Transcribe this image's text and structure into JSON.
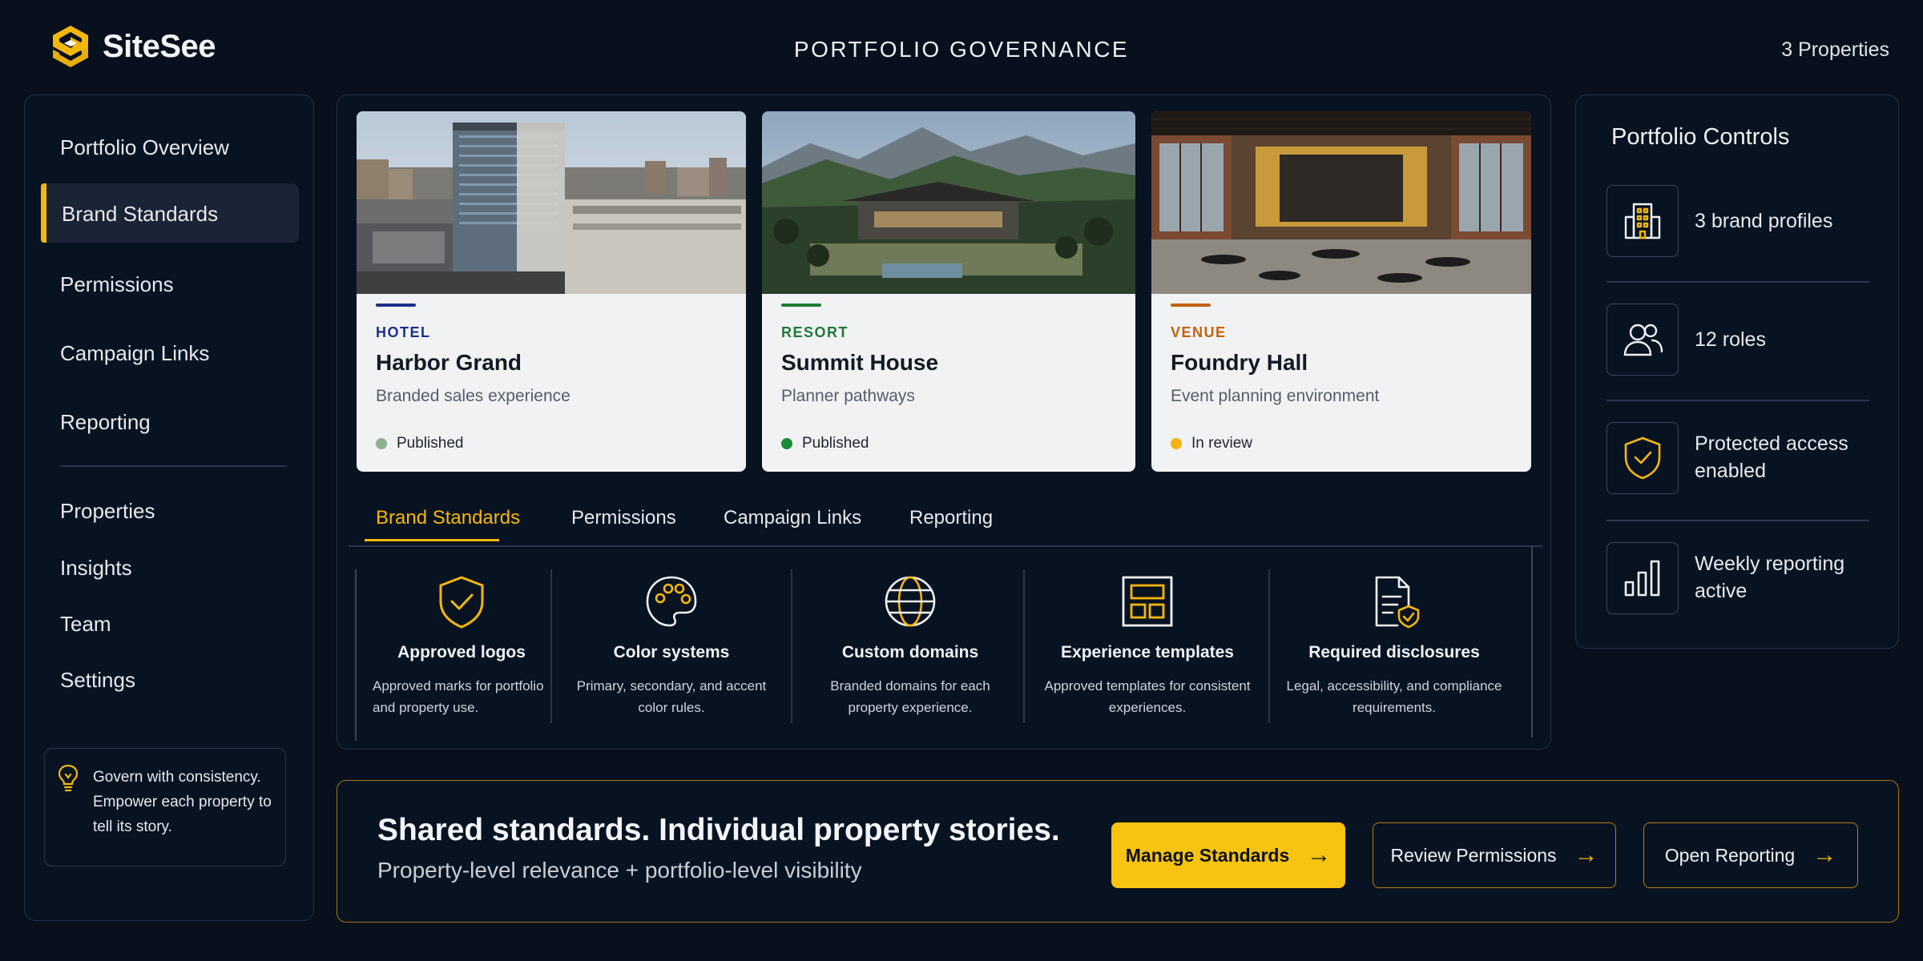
{
  "header": {
    "app_name": "SiteSee",
    "title": "PORTFOLIO GOVERNANCE",
    "property_count": "3 Properties"
  },
  "sidebar": {
    "items": [
      {
        "label": "Portfolio Overview"
      },
      {
        "label": "Brand Standards",
        "active": true
      },
      {
        "label": "Permissions"
      },
      {
        "label": "Campaign Links"
      },
      {
        "label": "Reporting"
      },
      {
        "label": "Properties"
      },
      {
        "label": "Insights"
      },
      {
        "label": "Team"
      },
      {
        "label": "Settings"
      }
    ],
    "tip": {
      "icon": "lightbulb-icon",
      "text": "Govern with consistency. Empower each property to tell its story."
    }
  },
  "properties": [
    {
      "type": "HOTEL",
      "type_color": "#1c2f8a",
      "name": "Harbor Grand",
      "description": "Branded sales experience",
      "status": "Published",
      "status_color": "#8fb08f"
    },
    {
      "type": "RESORT",
      "type_color": "#1e7a36",
      "name": "Summit House",
      "description": "Planner pathways",
      "status": "Published",
      "status_color": "#1e8a3a"
    },
    {
      "type": "VENUE",
      "type_color": "#c2620a",
      "name": "Foundry Hall",
      "description": "Event planning environment",
      "status": "In review",
      "status_color": "#f4b514"
    }
  ],
  "tabs": [
    {
      "label": "Brand Standards",
      "active": true
    },
    {
      "label": "Permissions"
    },
    {
      "label": "Campaign Links"
    },
    {
      "label": "Reporting"
    }
  ],
  "features": [
    {
      "icon": "shield-check-icon",
      "title": "Approved logos",
      "description": "Approved marks for portfolio and property use."
    },
    {
      "icon": "palette-icon",
      "title": "Color systems",
      "description": "Primary, secondary, and accent color rules."
    },
    {
      "icon": "globe-icon",
      "title": "Custom domains",
      "description": "Branded domains for each property experience."
    },
    {
      "icon": "template-icon",
      "title": "Experience templates",
      "description": "Approved templates for consistent experiences."
    },
    {
      "icon": "document-shield-icon",
      "title": "Required disclosures",
      "description": "Legal, accessibility, and compliance requirements."
    }
  ],
  "controls": {
    "title": "Portfolio Controls",
    "items": [
      {
        "icon": "building-icon",
        "text": "3 brand profiles"
      },
      {
        "icon": "users-icon",
        "text": "12 roles"
      },
      {
        "icon": "shield-check-icon",
        "text": "Protected access enabled"
      },
      {
        "icon": "bar-chart-icon",
        "text": "Weekly reporting active"
      }
    ]
  },
  "banner": {
    "title": "Shared standards. Individual property stories.",
    "subtitle": "Property-level relevance + portfolio-level visibility",
    "buttons": [
      {
        "label": "Manage Standards",
        "style": "primary"
      },
      {
        "label": "Review Permissions",
        "style": "outline"
      },
      {
        "label": "Open Reporting",
        "style": "outline"
      }
    ]
  },
  "colors": {
    "accent": "#f6b70b",
    "background": "#07101c",
    "panel_border": "#243145"
  }
}
